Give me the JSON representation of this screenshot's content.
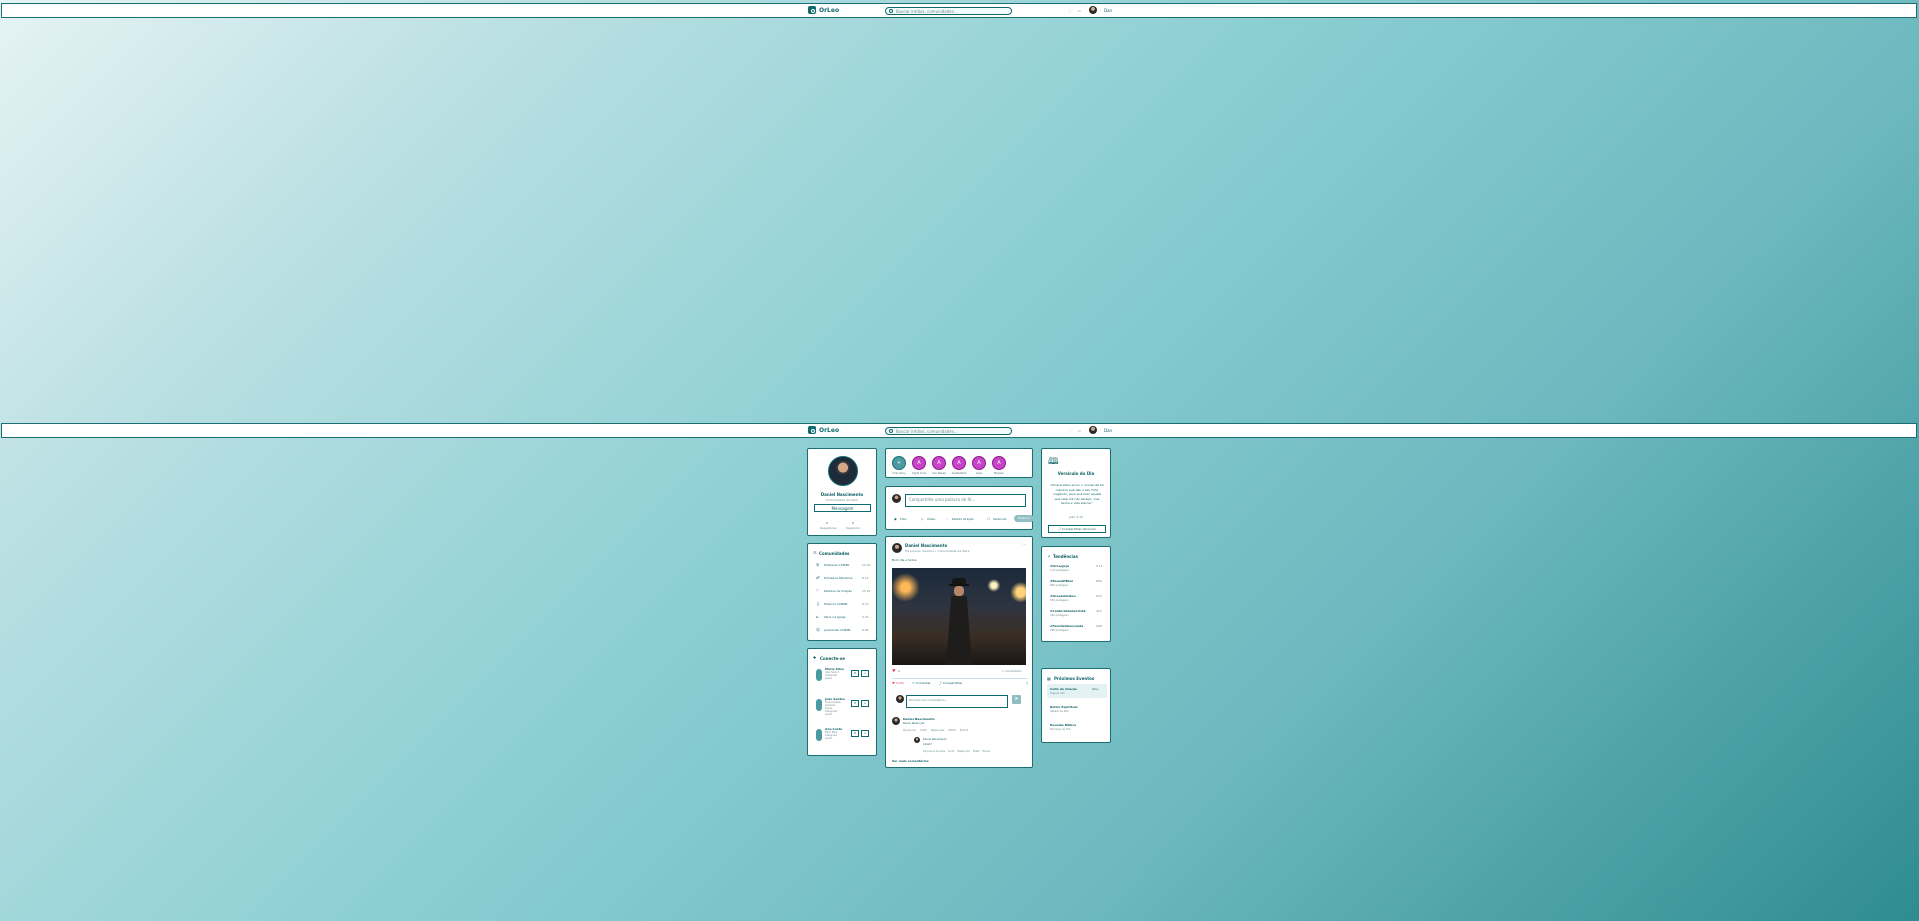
{
  "app": {
    "name": "OrLeo",
    "search_placeholder": "Buscar irmãos, comunidades...",
    "user_short": "Dan"
  },
  "profile": {
    "name": "Daniel Nascimento",
    "subtitle": "Comunidade da Obra",
    "message_btn": "Mensagem",
    "following_count": "0",
    "following_label": "Seguidores",
    "followers_count": "0",
    "followers_label": "Seguindo"
  },
  "communities": {
    "title": "Comunidades",
    "items": [
      {
        "label": "Mulheres CCB/BL",
        "count": "12.3k"
      },
      {
        "label": "Primeiros Ministros",
        "count": "8.1k"
      },
      {
        "label": "Pedidos de Oração",
        "count": "15.2k"
      },
      {
        "label": "Músicos CCB/BL",
        "count": "6.7k"
      },
      {
        "label": "Obra na Igreja",
        "count": "4.2k"
      },
      {
        "label": "Juventude CCB/BL",
        "count": "9.8k"
      }
    ]
  },
  "suggestions": {
    "title": "Conecte-se",
    "items": [
      {
        "name": "Maria Silva",
        "info": "Líder Nível 3 Intergrupal Jovens"
      },
      {
        "name": "João Santos",
        "info": "Grupo Auxiliar Apoiando Jovens Intergrupal Jovens"
      },
      {
        "name": "Ana Costa",
        "info": "Maior Nível Intergrupal Jovens"
      }
    ]
  },
  "stories": {
    "add_label": "Criar story",
    "items": [
      {
        "label": "Ingrid Lima"
      },
      {
        "label": "Iran Naves"
      },
      {
        "label": "Ana/Gabriel"
      },
      {
        "label": "Liara"
      },
      {
        "label": "Marcelo"
      }
    ]
  },
  "composer": {
    "placeholder": "Compartilhe uma palavra de fé...",
    "actions": [
      "Foto",
      "Vídeo",
      "Pedido Oração",
      "Versículo"
    ],
    "publish": "Publicar"
  },
  "post": {
    "author": "Daniel Nascimento",
    "meta": "Há poucos minutos • Comunidade da Obra",
    "text": "Bom dia a todos",
    "likes": "1",
    "comments_count": "1 comentário",
    "like_label": "Curtir",
    "comment_label": "Comentar",
    "share_label": "Compartilhar",
    "comment_placeholder": "Escreva um comentário...",
    "comment": {
      "author": "Daniel Nascimento",
      "text": "Deus abençoe",
      "actions": [
        "Há poucos",
        "Curtir",
        "Responder",
        "Editar",
        "Excluir"
      ],
      "reply": {
        "author": "Daniel Nascimento",
        "text": "Amém!",
        "actions": [
          "Há poucos minutos",
          "Curtir",
          "Responder",
          "Editar",
          "Excluir"
        ]
      }
    },
    "see_more": "Ver mais comentários"
  },
  "verse": {
    "title": "Versículo do Dia",
    "text": "\"Porque Deus amou o mundo de tal maneira que deu o seu Filho unigênito, para que todo aquele que nele crê não pereça, mas tenha a vida eterna.\"",
    "ref": "João 3:16",
    "share": "Compartilhar Versículo"
  },
  "trends": {
    "title": "Tendências",
    "items": [
      {
        "tag": "#OrLeoJeju",
        "sub": "1.2k postagens",
        "count": "2.1k"
      },
      {
        "tag": "#BoaoAltBlon",
        "sub": "856 postagens",
        "count": "856"
      },
      {
        "tag": "#OraçãoDeitou",
        "sub": "634 postagens",
        "count": "634"
      },
      {
        "tag": "#CantoriAdadeCristã",
        "sub": "412 postagens",
        "count": "412"
      },
      {
        "tag": "#FamíliaAbençoada",
        "sub": "298 postagens",
        "count": "298"
      }
    ]
  },
  "events": {
    "title": "Próximos Eventos",
    "items": [
      {
        "name": "Culto de Oração",
        "date": "Hoje às 19h",
        "badge": "Ativo"
      },
      {
        "name": "Retiro Espiritual",
        "date": "Sábado às 08h"
      },
      {
        "name": "Reunião Bíblica",
        "date": "Domingo às 10h"
      }
    ]
  },
  "colors": {
    "accent": "#0d6a6e",
    "story": "#c743c7"
  }
}
